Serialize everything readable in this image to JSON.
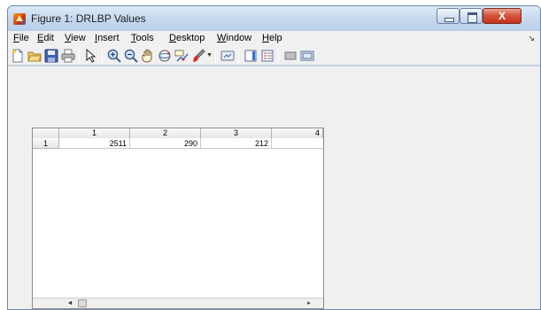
{
  "window": {
    "title": "Figure 1: DRLBP Values",
    "close_glyph": "X"
  },
  "menu": {
    "items": [
      {
        "key": "file",
        "acc": "F",
        "rest": "ile"
      },
      {
        "key": "edit",
        "acc": "E",
        "rest": "dit"
      },
      {
        "key": "view",
        "acc": "V",
        "rest": "iew"
      },
      {
        "key": "insert",
        "acc": "I",
        "rest": "nsert"
      },
      {
        "key": "tools",
        "acc": "T",
        "rest": "ools"
      },
      {
        "key": "desktop",
        "acc": "D",
        "rest": "esktop"
      },
      {
        "key": "window",
        "acc": "W",
        "rest": "indow"
      },
      {
        "key": "help",
        "acc": "H",
        "rest": "elp"
      }
    ],
    "overflow_arrow": "↘"
  },
  "toolbar": {
    "icons": [
      "new-figure-icon",
      "open-file-icon",
      "save-figure-icon",
      "print-figure-icon",
      "edit-plot-icon",
      "zoom-in-icon",
      "zoom-out-icon",
      "pan-icon",
      "rotate-3d-icon",
      "data-cursor-icon",
      "brush-icon",
      "brush-dropdown-icon",
      "link-plot-icon",
      "insert-colorbar-icon",
      "insert-legend-icon",
      "hide-plot-tools-icon",
      "show-plot-tools-icon"
    ]
  },
  "table": {
    "column_headers": [
      "1",
      "2",
      "3",
      "4"
    ],
    "rows": [
      {
        "header": "1",
        "cells": [
          "2511",
          "290",
          "212",
          ""
        ]
      }
    ]
  },
  "scrollbar": {
    "left_arrow": "◄",
    "right_arrow": "▸"
  }
}
